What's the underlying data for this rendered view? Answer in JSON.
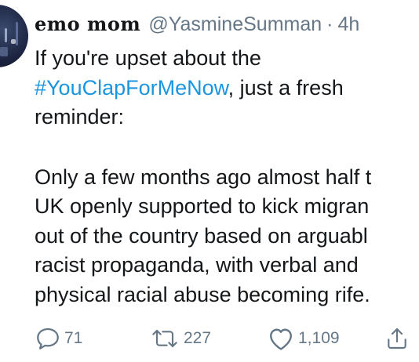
{
  "tweet": {
    "display_name": "emo mom",
    "handle": "@YasmineSumman",
    "separator": "·",
    "time": "4h",
    "body": {
      "line1": "If you're upset about the",
      "hashtag": "#YouClapForMeNow",
      "line2_rest": ", just a fresh",
      "line3": "reminder:",
      "line4": "Only a few months ago almost half t",
      "line5": "UK openly supported to kick migran",
      "line6": "out of the country based on arguabl",
      "line7": "racist propaganda, with verbal and",
      "line8": "physical racial abuse becoming rife."
    },
    "actions": {
      "reply_icon": "reply-icon",
      "reply_count": "71",
      "retweet_icon": "retweet-icon",
      "retweet_count": "227",
      "like_icon": "heart-icon",
      "like_count": "1,109",
      "share_icon": "share-icon"
    }
  },
  "colors": {
    "text": "#14171a",
    "secondary": "#657786",
    "link": "#1b95e0",
    "background": "#ffffff"
  }
}
